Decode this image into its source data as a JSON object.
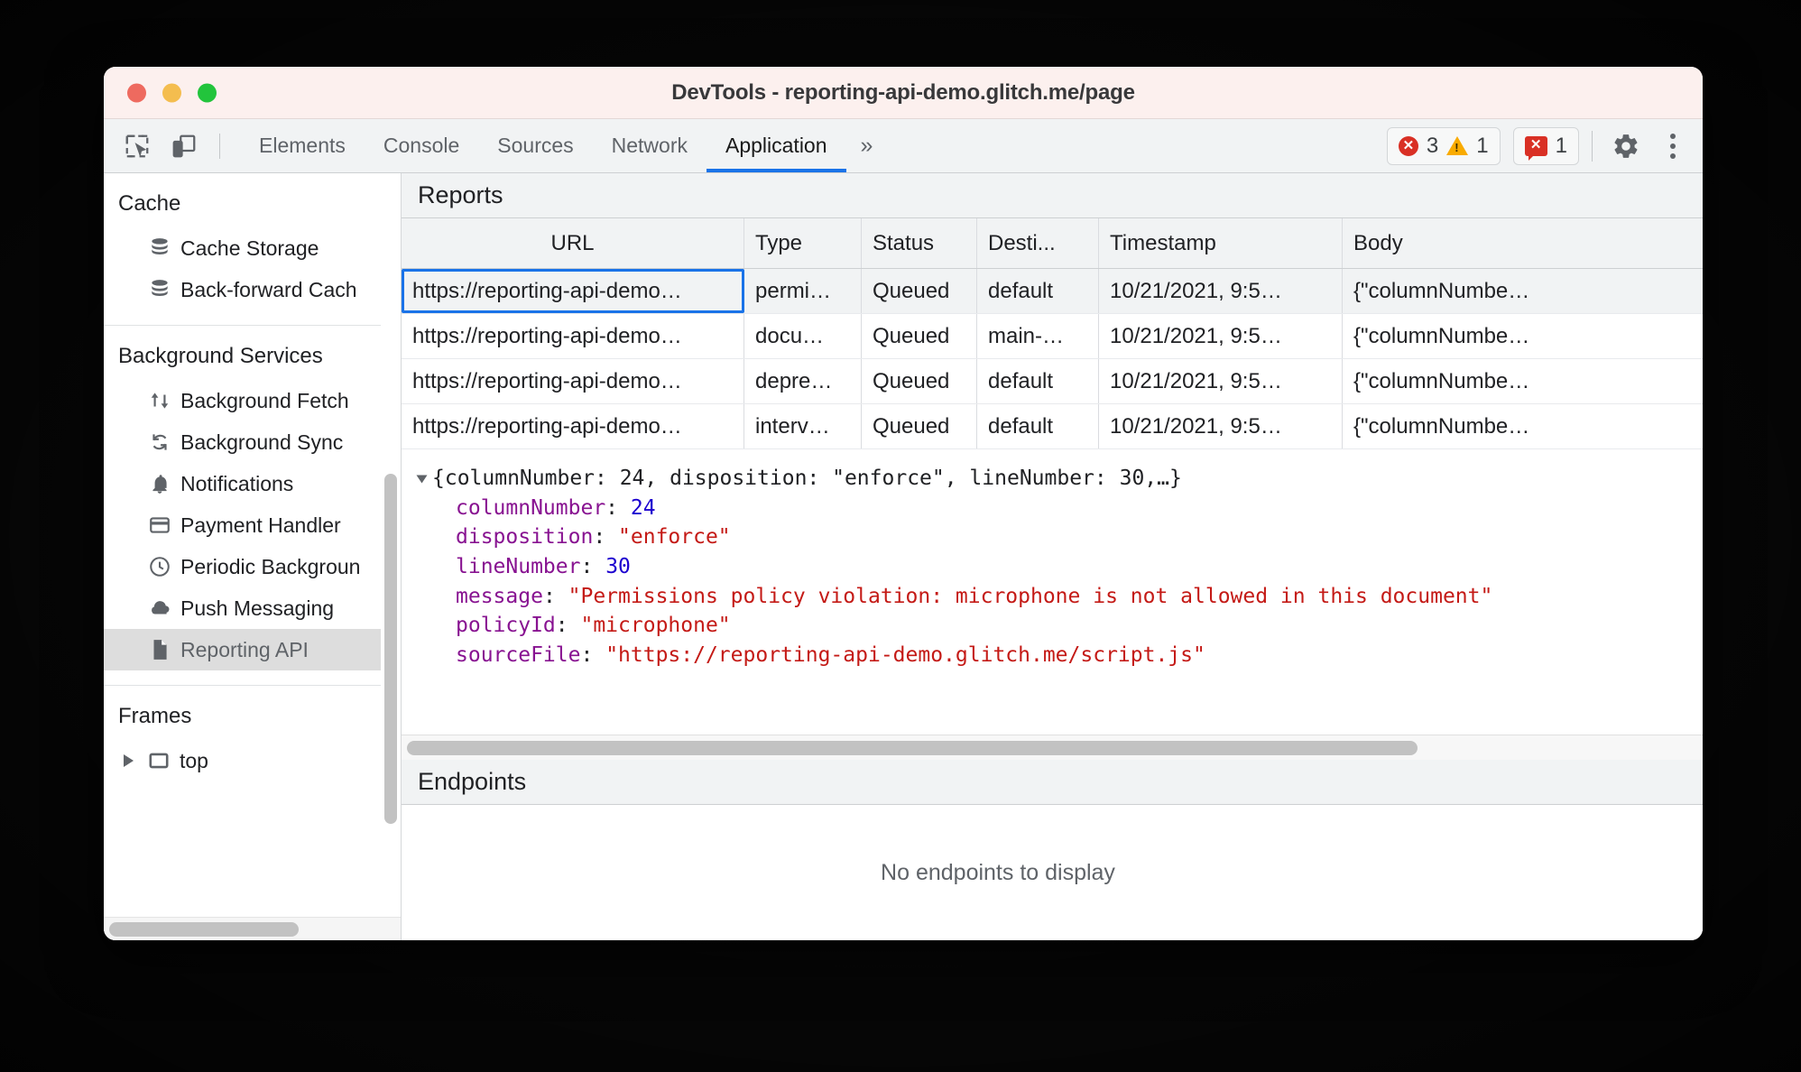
{
  "window": {
    "title": "DevTools - reporting-api-demo.glitch.me/page",
    "traffic_lights": [
      "close-red",
      "minimize-amber",
      "maximize-green"
    ]
  },
  "toolbar": {
    "inspect_icon": "inspect-element-icon",
    "device_icon": "device-toolbar-icon",
    "tabs": [
      {
        "label": "Elements",
        "active": false
      },
      {
        "label": "Console",
        "active": false
      },
      {
        "label": "Sources",
        "active": false
      },
      {
        "label": "Network",
        "active": false
      },
      {
        "label": "Application",
        "active": true
      }
    ],
    "more_tabs_label": "»",
    "errors_count": "3",
    "warnings_count": "1",
    "issues_count": "1",
    "settings_icon": "gear-icon",
    "menu_icon": "kebab-menu-icon",
    "accent_color": "#1a73e8"
  },
  "sidebar": {
    "groups": [
      {
        "title": "Cache",
        "items": [
          {
            "label": "Cache Storage",
            "icon": "database-icon",
            "selected": false
          },
          {
            "label": "Back-forward Cach",
            "icon": "database-icon",
            "selected": false
          }
        ]
      },
      {
        "title": "Background Services",
        "items": [
          {
            "label": "Background Fetch",
            "icon": "up-down-arrows-icon",
            "selected": false
          },
          {
            "label": "Background Sync",
            "icon": "sync-icon",
            "selected": false
          },
          {
            "label": "Notifications",
            "icon": "bell-icon",
            "selected": false
          },
          {
            "label": "Payment Handler",
            "icon": "credit-card-icon",
            "selected": false
          },
          {
            "label": "Periodic Backgroun",
            "icon": "clock-icon",
            "selected": false
          },
          {
            "label": "Push Messaging",
            "icon": "cloud-icon",
            "selected": false
          },
          {
            "label": "Reporting API",
            "icon": "document-icon",
            "selected": true
          }
        ]
      },
      {
        "title": "Frames",
        "items": [
          {
            "label": "top",
            "icon": "frame-icon",
            "selected": false,
            "expander": "chevron-right-icon"
          }
        ]
      }
    ]
  },
  "reports": {
    "section_title": "Reports",
    "columns": [
      "URL",
      "Type",
      "Status",
      "Desti...",
      "Timestamp",
      "Body"
    ],
    "rows": [
      {
        "url": "https://reporting-api-demo…",
        "type": "permi…",
        "status": "Queued",
        "destination": "default",
        "timestamp": "10/21/2021, 9:5…",
        "body": "{\"columnNumbe…",
        "selected": true
      },
      {
        "url": "https://reporting-api-demo…",
        "type": "docu…",
        "status": "Queued",
        "destination": "main-…",
        "timestamp": "10/21/2021, 9:5…",
        "body": "{\"columnNumbe…",
        "selected": false
      },
      {
        "url": "https://reporting-api-demo…",
        "type": "depre…",
        "status": "Queued",
        "destination": "default",
        "timestamp": "10/21/2021, 9:5…",
        "body": "{\"columnNumbe…",
        "selected": false
      },
      {
        "url": "https://reporting-api-demo…",
        "type": "interv…",
        "status": "Queued",
        "destination": "default",
        "timestamp": "10/21/2021, 9:5…",
        "body": "{\"columnNumbe…",
        "selected": false
      }
    ]
  },
  "body_preview": {
    "summary": "{columnNumber: 24, disposition: \"enforce\", lineNumber: 30,…}",
    "properties": [
      {
        "key": "columnNumber",
        "value": "24",
        "kind": "number"
      },
      {
        "key": "disposition",
        "value": "\"enforce\"",
        "kind": "string"
      },
      {
        "key": "lineNumber",
        "value": "30",
        "kind": "number"
      },
      {
        "key": "message",
        "value": "\"Permissions policy violation: microphone is not allowed in this document\"",
        "kind": "string"
      },
      {
        "key": "policyId",
        "value": "\"microphone\"",
        "kind": "string"
      },
      {
        "key": "sourceFile",
        "value": "\"https://reporting-api-demo.glitch.me/script.js\"",
        "kind": "string"
      }
    ],
    "colors": {
      "key": "#881391",
      "string": "#c41a16",
      "number": "#1c00cf"
    }
  },
  "endpoints": {
    "section_title": "Endpoints",
    "empty_message": "No endpoints to display"
  }
}
